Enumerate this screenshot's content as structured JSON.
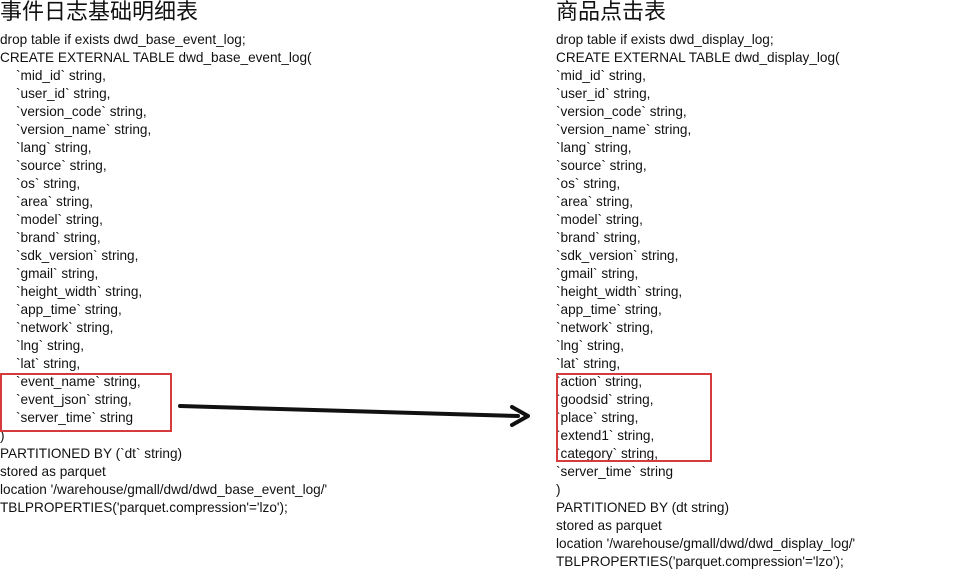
{
  "left": {
    "title": "事件日志基础明细表",
    "lines": [
      {
        "text": "drop table if exists dwd_base_event_log;",
        "indent": false
      },
      {
        "text": "CREATE EXTERNAL TABLE dwd_base_event_log(",
        "indent": false
      },
      {
        "text": "`mid_id` string,",
        "indent": true
      },
      {
        "text": "`user_id` string,",
        "indent": true
      },
      {
        "text": "`version_code` string,",
        "indent": true
      },
      {
        "text": "`version_name` string,",
        "indent": true
      },
      {
        "text": "`lang` string,",
        "indent": true
      },
      {
        "text": "`source` string,",
        "indent": true
      },
      {
        "text": "`os` string,",
        "indent": true
      },
      {
        "text": "`area` string,",
        "indent": true
      },
      {
        "text": "`model` string,",
        "indent": true
      },
      {
        "text": "`brand` string,",
        "indent": true
      },
      {
        "text": "`sdk_version` string,",
        "indent": true
      },
      {
        "text": "`gmail` string,",
        "indent": true
      },
      {
        "text": "`height_width` string,",
        "indent": true
      },
      {
        "text": "`app_time` string,",
        "indent": true
      },
      {
        "text": "`network` string,",
        "indent": true
      },
      {
        "text": "`lng` string,",
        "indent": true
      },
      {
        "text": "`lat` string,",
        "indent": true
      },
      {
        "text": "`event_name` string,",
        "indent": true
      },
      {
        "text": "`event_json` string,",
        "indent": true
      },
      {
        "text": "`server_time` string",
        "indent": true
      },
      {
        "text": ")",
        "indent": false
      },
      {
        "text": "PARTITIONED BY (`dt` string)",
        "indent": false
      },
      {
        "text": "stored as parquet",
        "indent": false
      },
      {
        "text": "location '/warehouse/gmall/dwd/dwd_base_event_log/'",
        "indent": false
      },
      {
        "text": "TBLPROPERTIES('parquet.compression'='lzo');",
        "indent": false
      }
    ]
  },
  "right": {
    "title": "商品点击表",
    "lines": [
      {
        "text": "drop table if exists dwd_display_log;",
        "indent": false
      },
      {
        "text": "CREATE EXTERNAL TABLE dwd_display_log(",
        "indent": false
      },
      {
        "text": "`mid_id` string,",
        "indent": false
      },
      {
        "text": "`user_id` string,",
        "indent": false
      },
      {
        "text": "`version_code` string,",
        "indent": false
      },
      {
        "text": "`version_name` string,",
        "indent": false
      },
      {
        "text": "`lang` string,",
        "indent": false
      },
      {
        "text": "`source` string,",
        "indent": false
      },
      {
        "text": "`os` string,",
        "indent": false
      },
      {
        "text": "`area` string,",
        "indent": false
      },
      {
        "text": "`model` string,",
        "indent": false
      },
      {
        "text": "`brand` string,",
        "indent": false
      },
      {
        "text": "`sdk_version` string,",
        "indent": false
      },
      {
        "text": "`gmail` string,",
        "indent": false
      },
      {
        "text": "`height_width` string,",
        "indent": false
      },
      {
        "text": "`app_time` string,",
        "indent": false
      },
      {
        "text": "`network` string,",
        "indent": false
      },
      {
        "text": "`lng` string,",
        "indent": false
      },
      {
        "text": "`lat` string,",
        "indent": false
      },
      {
        "text": "`action` string,",
        "indent": false
      },
      {
        "text": "`goodsid` string,",
        "indent": false
      },
      {
        "text": "`place` string,",
        "indent": false
      },
      {
        "text": "`extend1` string,",
        "indent": false
      },
      {
        "text": "`category` string,",
        "indent": false
      },
      {
        "text": "`server_time` string",
        "indent": false
      },
      {
        "text": ")",
        "indent": false
      },
      {
        "text": "PARTITIONED BY (dt string)",
        "indent": false
      },
      {
        "text": "stored as parquet",
        "indent": false
      },
      {
        "text": "location '/warehouse/gmall/dwd/dwd_display_log/'",
        "indent": false
      },
      {
        "text": "TBLPROPERTIES('parquet.compression'='lzo');",
        "indent": false
      }
    ]
  },
  "colors": {
    "highlight": "#d63a3a",
    "arrow": "#111111"
  }
}
